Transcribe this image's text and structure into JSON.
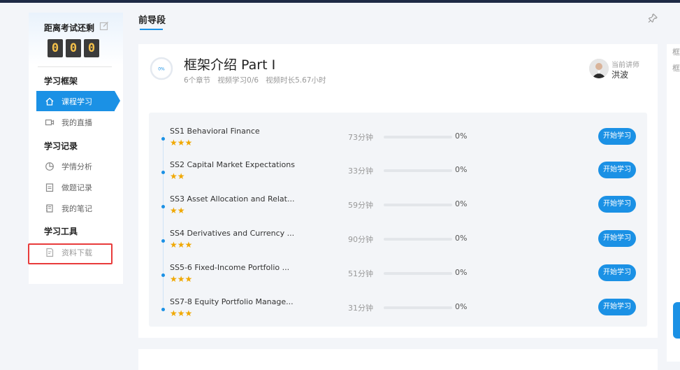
{
  "sidebar": {
    "countdown_title": "距离考试还剩",
    "digits": [
      "0",
      "0",
      "0"
    ],
    "sections": [
      {
        "title": "学习框架",
        "items": [
          {
            "label": "课程学习",
            "icon": "home-icon",
            "active": true
          },
          {
            "label": "我的直播",
            "icon": "video-icon",
            "active": false
          }
        ]
      },
      {
        "title": "学习记录",
        "items": [
          {
            "label": "学情分析",
            "icon": "pie-chart-icon",
            "active": false
          },
          {
            "label": "做题记录",
            "icon": "clipboard-icon",
            "active": false
          },
          {
            "label": "我的笔记",
            "icon": "notebook-icon",
            "active": false
          }
        ]
      },
      {
        "title": "学习工具",
        "items": [
          {
            "label": "资料下载",
            "icon": "document-download-icon",
            "active": false
          }
        ]
      }
    ]
  },
  "header": {
    "tab_label": "前导段"
  },
  "course": {
    "progress_label": "0%",
    "progress": 0,
    "title": "框架介绍 Part I",
    "meta": [
      "6个章节",
      "视频学习0/6",
      "视频时长5.67小时"
    ],
    "teacher_label": "当前讲师",
    "teacher_name": "洪波"
  },
  "chapters": [
    {
      "title": "SS1 Behavioral Finance",
      "stars": 3,
      "duration": "73分钟",
      "progress": 0,
      "percent": "0%",
      "button": "开始学习"
    },
    {
      "title": "SS2 Capital Market Expectations",
      "stars": 2,
      "duration": "33分钟",
      "progress": 0,
      "percent": "0%",
      "button": "开始学习"
    },
    {
      "title": "SS3 Asset Allocation and Relat...",
      "stars": 2,
      "duration": "59分钟",
      "progress": 0,
      "percent": "0%",
      "button": "开始学习"
    },
    {
      "title": "SS4 Derivatives and Currency ...",
      "stars": 3,
      "duration": "90分钟",
      "progress": 0,
      "percent": "0%",
      "button": "开始学习"
    },
    {
      "title": "SS5-6 Fixed-Income Portfolio ...",
      "stars": 3,
      "duration": "51分钟",
      "progress": 0,
      "percent": "0%",
      "button": "开始学习"
    },
    {
      "title": "SS7-8 Equity Portfolio Manage...",
      "stars": 3,
      "duration": "31分钟",
      "progress": 0,
      "percent": "0%",
      "button": "开始学习"
    }
  ],
  "right_panel": {
    "items": [
      "框",
      "框"
    ]
  },
  "colors": {
    "accent": "#1b91e5",
    "star": "#f0a800",
    "highlight": "#e83b3b",
    "digit_bg": "#3b3b3b",
    "digit_fg": "#f5c14b"
  }
}
